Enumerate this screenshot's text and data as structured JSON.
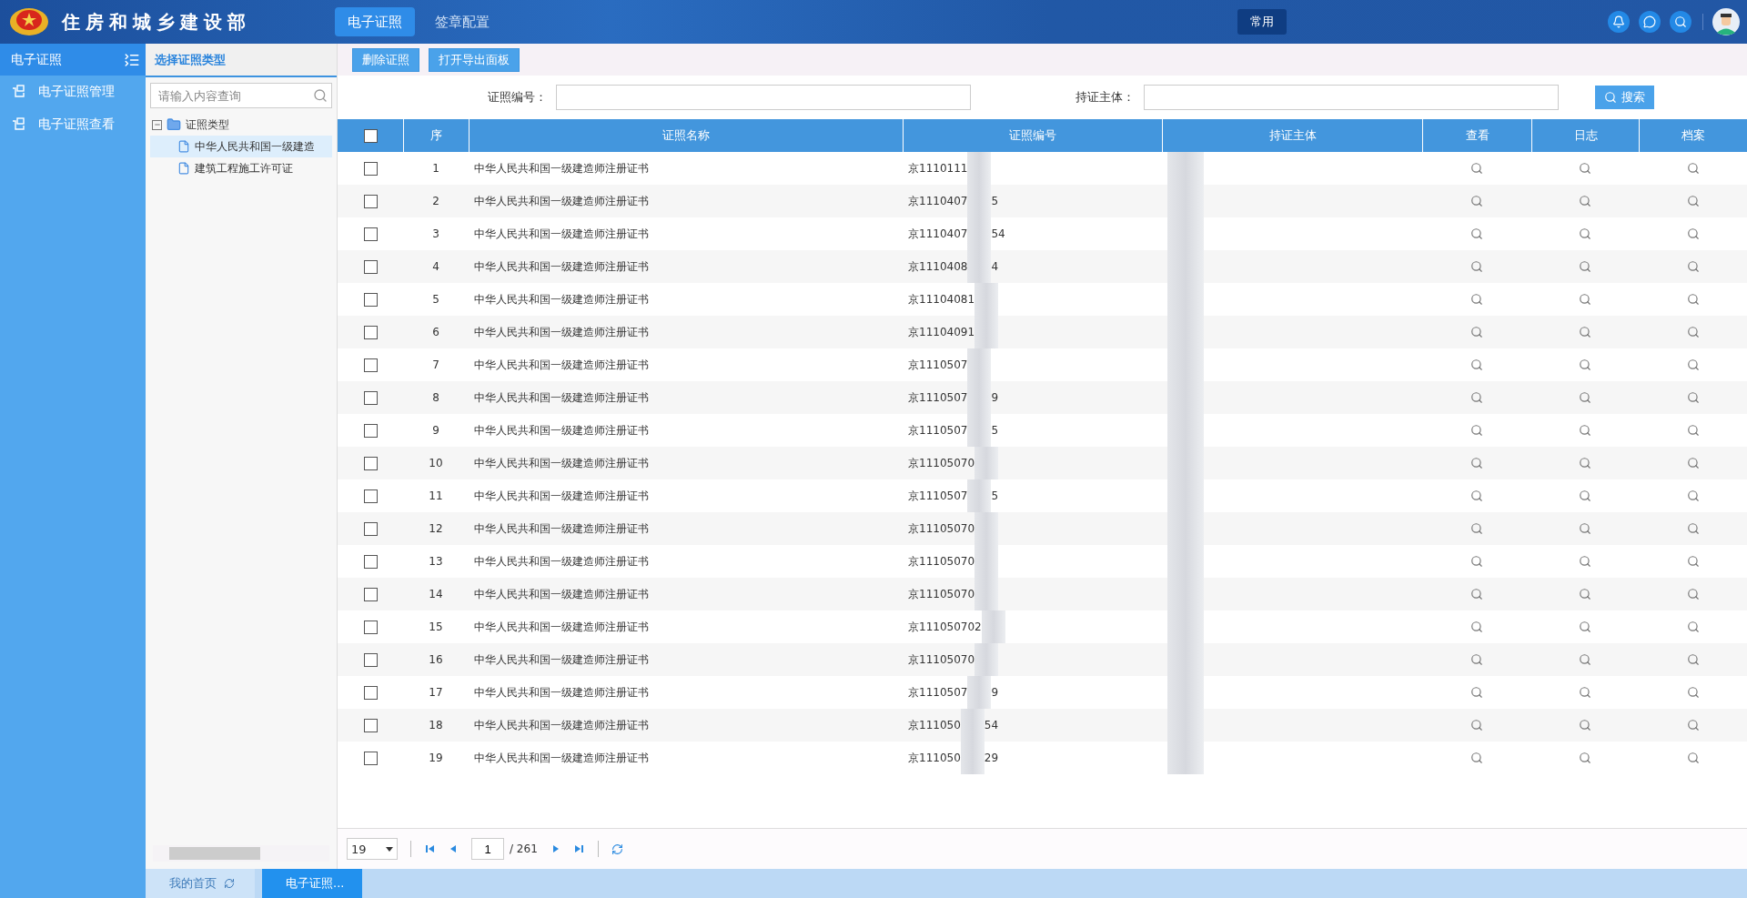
{
  "header": {
    "title": "住房和城乡建设部",
    "nav_tabs": [
      {
        "label": "电子证照",
        "selected": true
      },
      {
        "label": "签章配置",
        "selected": false
      }
    ],
    "quick_button": "常用"
  },
  "sidebar": {
    "title": "电子证照",
    "items": [
      {
        "label": "电子证照管理"
      },
      {
        "label": "电子证照查看"
      }
    ]
  },
  "tree_panel": {
    "title": "选择证照类型",
    "search": {
      "placeholder": "请输入内容查询"
    },
    "tree": {
      "label": "证照类型",
      "expanded": true,
      "children": [
        {
          "label": "中华人民共和国一级建造",
          "selected": true
        },
        {
          "label": "建筑工程施工许可证",
          "selected": false
        }
      ]
    }
  },
  "toolbar": {
    "buttons": [
      "删除证照",
      "打开导出面板"
    ]
  },
  "search_form": {
    "fields": [
      {
        "label": "证照编号："
      },
      {
        "label": "持证主体："
      }
    ],
    "button": "搜索"
  },
  "table": {
    "header_checked": false,
    "columns": [
      "序",
      "证照名称",
      "证照编号",
      "持证主体",
      "查看",
      "日志",
      "档案"
    ],
    "rows": [
      {
        "index": "1",
        "name": "中华人民共和国一级建造师注册证书",
        "cert_prefix": "京1110111",
        "checked": false
      },
      {
        "index": "2",
        "name": "中华人民共和国一级建造师注册证书",
        "cert_prefix": "京1110407",
        "cert_suffix": "5",
        "checked": false
      },
      {
        "index": "3",
        "name": "中华人民共和国一级建造师注册证书",
        "cert_prefix": "京1110407",
        "cert_suffix": "54",
        "checked": false
      },
      {
        "index": "4",
        "name": "中华人民共和国一级建造师注册证书",
        "cert_prefix": "京1110408",
        "cert_suffix": "4",
        "checked": false
      },
      {
        "index": "5",
        "name": "中华人民共和国一级建造师注册证书",
        "cert_prefix": "京11104081",
        "checked": false
      },
      {
        "index": "6",
        "name": "中华人民共和国一级建造师注册证书",
        "cert_prefix": "京11104091",
        "checked": false
      },
      {
        "index": "7",
        "name": "中华人民共和国一级建造师注册证书",
        "cert_prefix": "京1110507",
        "checked": false
      },
      {
        "index": "8",
        "name": "中华人民共和国一级建造师注册证书",
        "cert_prefix": "京1110507",
        "cert_suffix": "9",
        "checked": false
      },
      {
        "index": "9",
        "name": "中华人民共和国一级建造师注册证书",
        "cert_prefix": "京1110507",
        "cert_suffix": "5",
        "checked": false
      },
      {
        "index": "10",
        "name": "中华人民共和国一级建造师注册证书",
        "cert_prefix": "京11105070",
        "checked": false
      },
      {
        "index": "11",
        "name": "中华人民共和国一级建造师注册证书",
        "cert_prefix": "京1110507",
        "cert_suffix": "5",
        "checked": false
      },
      {
        "index": "12",
        "name": "中华人民共和国一级建造师注册证书",
        "cert_prefix": "京11105070",
        "checked": false
      },
      {
        "index": "13",
        "name": "中华人民共和国一级建造师注册证书",
        "cert_prefix": "京11105070",
        "checked": false
      },
      {
        "index": "14",
        "name": "中华人民共和国一级建造师注册证书",
        "cert_prefix": "京11105070",
        "checked": false
      },
      {
        "index": "15",
        "name": "中华人民共和国一级建造师注册证书",
        "cert_prefix": "京111050702",
        "checked": false
      },
      {
        "index": "16",
        "name": "中华人民共和国一级建造师注册证书",
        "cert_prefix": "京11105070",
        "checked": false
      },
      {
        "index": "17",
        "name": "中华人民共和国一级建造师注册证书",
        "cert_prefix": "京1110507",
        "cert_suffix": "9",
        "checked": false
      },
      {
        "index": "18",
        "name": "中华人民共和国一级建造师注册证书",
        "cert_prefix": "京111050",
        "cert_suffix": "54",
        "checked": false
      },
      {
        "index": "19",
        "name": "中华人民共和国一级建造师注册证书",
        "cert_prefix": "京111050",
        "cert_suffix": "29",
        "checked": false
      }
    ]
  },
  "pagination": {
    "page_size": "19",
    "page": "1",
    "total": "/ 261"
  },
  "bottom_tabs": [
    {
      "label": "我的首页",
      "selected": false,
      "kind": "home"
    },
    {
      "label": "电子证照...",
      "selected": true,
      "kind": "page"
    }
  ]
}
